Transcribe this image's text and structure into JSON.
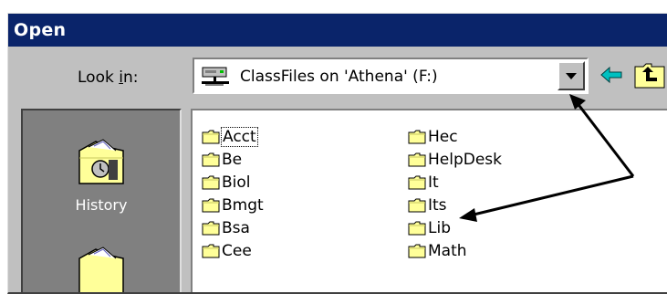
{
  "dialog": {
    "title": "Open"
  },
  "lookin": {
    "label": "Look in:",
    "value": "ClassFiles on 'Athena' (F:)",
    "icon": "network-drive-icon"
  },
  "toolbar": {
    "back_icon": "back-arrow-icon",
    "up_icon": "up-folder-icon"
  },
  "places": {
    "items": [
      {
        "label": "History",
        "icon": "history-folder-icon"
      }
    ]
  },
  "files": {
    "col1": [
      "Acct",
      "Be",
      "Biol",
      "Bmgt",
      "Bsa",
      "Cee"
    ],
    "col2": [
      "Hec",
      "HelpDesk",
      "It",
      "Its",
      "Lib",
      "Math"
    ]
  },
  "colors": {
    "titlebar": "#0a246a",
    "window": "#c0c0c0",
    "places_bar": "#808080",
    "folder": "#ffff99"
  }
}
